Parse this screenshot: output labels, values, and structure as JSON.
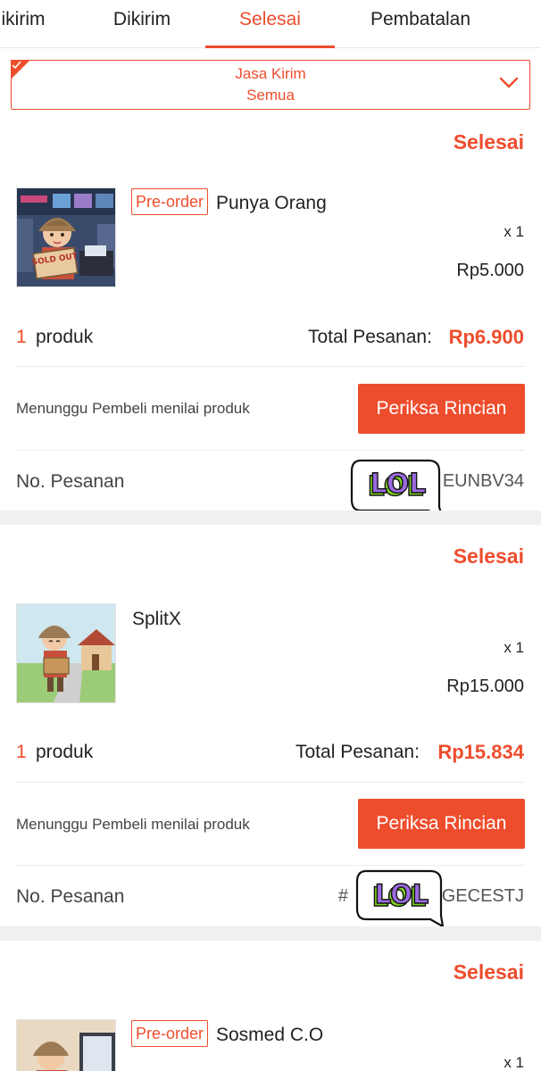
{
  "tabs": [
    {
      "label": "ikirim"
    },
    {
      "label": "Dikirim"
    },
    {
      "label": "Selesai",
      "active": true
    },
    {
      "label": "Pembatalan"
    }
  ],
  "filter": {
    "title": "Jasa Kirim",
    "value": "Semua"
  },
  "colors": {
    "accent": "#ee4d2d",
    "separator": "#f0f0f0"
  },
  "orders": [
    {
      "status": "Selesai",
      "badge": "Pre-order",
      "product_name": "Punya Orang",
      "thumbnail_text": "SOLD OUT",
      "qty": "x 1",
      "price": "Rp5.000",
      "count": "1",
      "count_label": "produk",
      "total_label": "Total Pesanan:",
      "total": "Rp6.900",
      "note": "Menunggu Pembeli menilai produk",
      "button": "Periksa Rincian",
      "order_no_label": "No. Pesanan",
      "order_no_visible": "EUNBV34",
      "sticker": "LOL"
    },
    {
      "status": "Selesai",
      "badge": "",
      "product_name": "SplitX",
      "qty": "x 1",
      "price": "Rp15.000",
      "count": "1",
      "count_label": "produk",
      "total_label": "Total Pesanan:",
      "total": "Rp15.834",
      "note": "Menunggu Pembeli menilai produk",
      "button": "Periksa Rincian",
      "order_no_label": "No. Pesanan",
      "order_no_prefix": "#",
      "order_no_visible": "GECESTJ",
      "sticker": "LOL"
    },
    {
      "status": "Selesai",
      "badge": "Pre-order",
      "product_name": "Sosmed C.O",
      "qty": "x 1"
    }
  ]
}
